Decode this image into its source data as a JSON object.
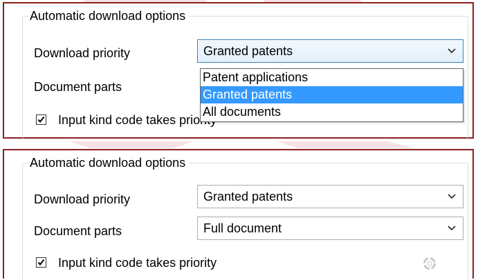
{
  "top_panel": {
    "group_title": "Automatic download options",
    "download_priority_label": "Download priority",
    "download_priority_value": "Granted patents",
    "document_parts_label": "Document parts",
    "checkbox_label": "Input kind code takes priority",
    "checkbox_checked": true,
    "dropdown_options": [
      "Patent applications",
      "Granted patents",
      "All documents"
    ],
    "dropdown_selected_index": 1
  },
  "bottom_panel": {
    "group_title": "Automatic download options",
    "download_priority_label": "Download priority",
    "download_priority_value": "Granted patents",
    "document_parts_label": "Document parts",
    "document_parts_value": "Full document",
    "checkbox_label": "Input kind code takes priority",
    "checkbox_checked": true
  },
  "colors": {
    "panel_border": "#8b1e1e",
    "selection": "#3399ff",
    "focus_border": "#3c7fb1"
  }
}
